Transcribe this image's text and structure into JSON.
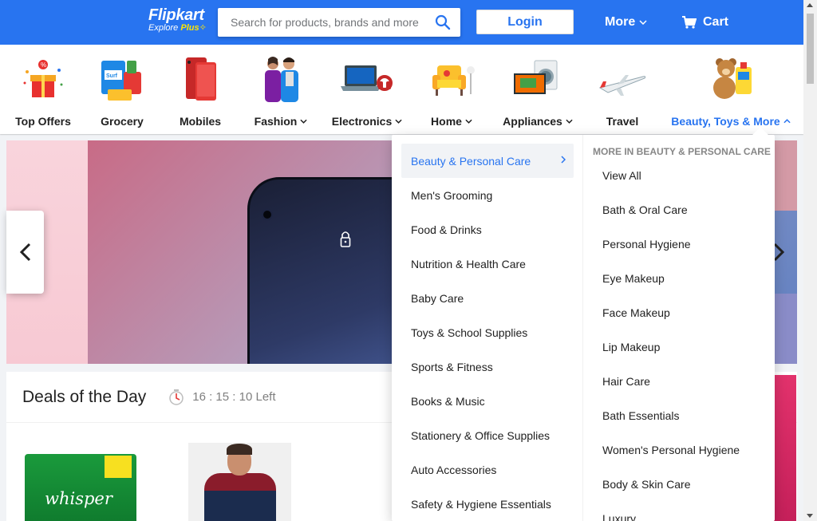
{
  "header": {
    "brand": "Flipkart",
    "tagline_prefix": "Explore ",
    "tagline_plus": "Plus",
    "search_placeholder": "Search for products, brands and more",
    "login_label": "Login",
    "more_label": "More",
    "cart_label": "Cart",
    "colors": {
      "primary": "#2874f0",
      "accent": "#ffe500"
    }
  },
  "nav": {
    "items": [
      {
        "label": "Top Offers",
        "icon": "gift-box-icon",
        "dropdown": false
      },
      {
        "label": "Grocery",
        "icon": "grocery-icon",
        "dropdown": false
      },
      {
        "label": "Mobiles",
        "icon": "mobile-phone-icon",
        "dropdown": false
      },
      {
        "label": "Fashion",
        "icon": "fashion-icon",
        "dropdown": true
      },
      {
        "label": "Electronics",
        "icon": "laptop-icon",
        "dropdown": true
      },
      {
        "label": "Home",
        "icon": "armchair-icon",
        "dropdown": true
      },
      {
        "label": "Appliances",
        "icon": "washing-machine-icon",
        "dropdown": true
      },
      {
        "label": "Travel",
        "icon": "airplane-icon",
        "dropdown": false
      },
      {
        "label": "Beauty, Toys & More",
        "icon": "teddy-bear-icon",
        "dropdown": true,
        "active": true
      }
    ]
  },
  "deals": {
    "title": "Deals of the Day",
    "timer": "16 : 15 : 10 Left",
    "product1_brand": "whisper"
  },
  "dropdown": {
    "categories": [
      "Beauty & Personal Care",
      "Men's Grooming",
      "Food & Drinks",
      "Nutrition & Health Care",
      "Baby Care",
      "Toys & School Supplies",
      "Sports & Fitness",
      "Books & Music",
      "Stationery & Office Supplies",
      "Auto Accessories",
      "Safety & Hygiene Essentials"
    ],
    "sub_heading": "MORE IN BEAUTY & PERSONAL CARE",
    "subcategories": [
      "View All",
      "Bath & Oral Care",
      "Personal Hygiene",
      "Eye Makeup",
      "Face Makeup",
      "Lip Makeup",
      "Hair Care",
      "Bath Essentials",
      "Women's Personal Hygiene",
      "Body & Skin Care",
      "Luxury"
    ]
  }
}
